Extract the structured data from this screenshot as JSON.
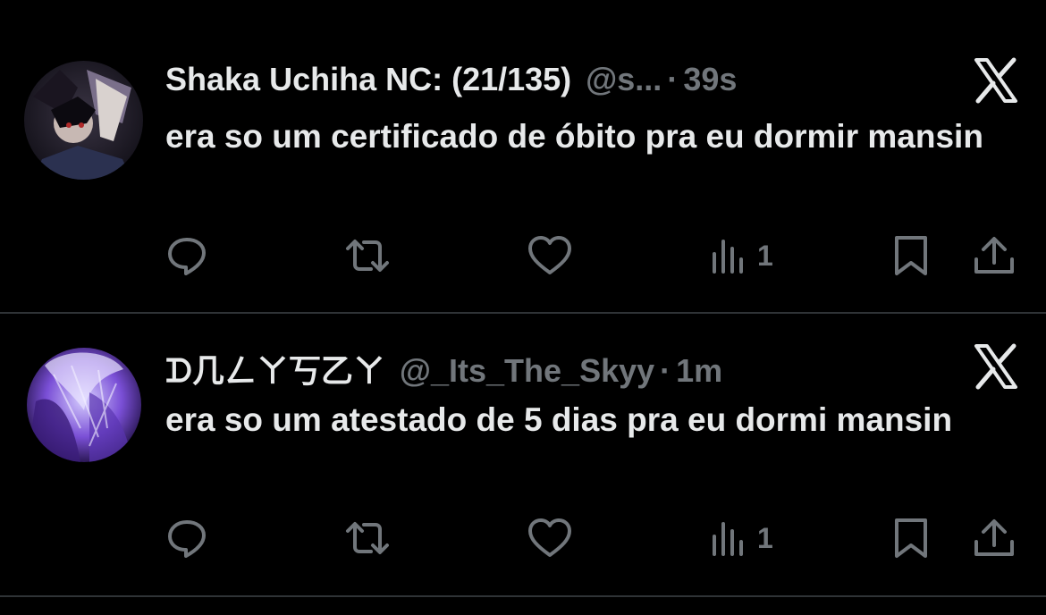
{
  "tweets": [
    {
      "display_name": "Shaka Uchiha NC: (21/135)",
      "handle": "@s...",
      "separator": "·",
      "time": "39s",
      "text": "era so um certificado de óbito pra eu dormir mansin",
      "views": "1",
      "avatar": "anime-character-avatar"
    },
    {
      "display_name": "ᗪ几ㄥㄚ丂乙ㄚ",
      "handle": "@_Its_The_Skyy",
      "separator": "·",
      "time": "1m",
      "text": "era so um atestado de 5 dias pra eu dormi mansin",
      "views": "1",
      "avatar": "purple-portrait-avatar"
    }
  ],
  "icons": {
    "reply": "reply-icon",
    "retweet": "retweet-icon",
    "like": "heart-icon",
    "views": "views-icon",
    "bookmark": "bookmark-icon",
    "share": "share-icon",
    "logo": "x-logo-icon"
  },
  "colors": {
    "background": "#000000",
    "text": "#e7e9ea",
    "secondary": "#71767b",
    "divider": "#2f3336"
  }
}
